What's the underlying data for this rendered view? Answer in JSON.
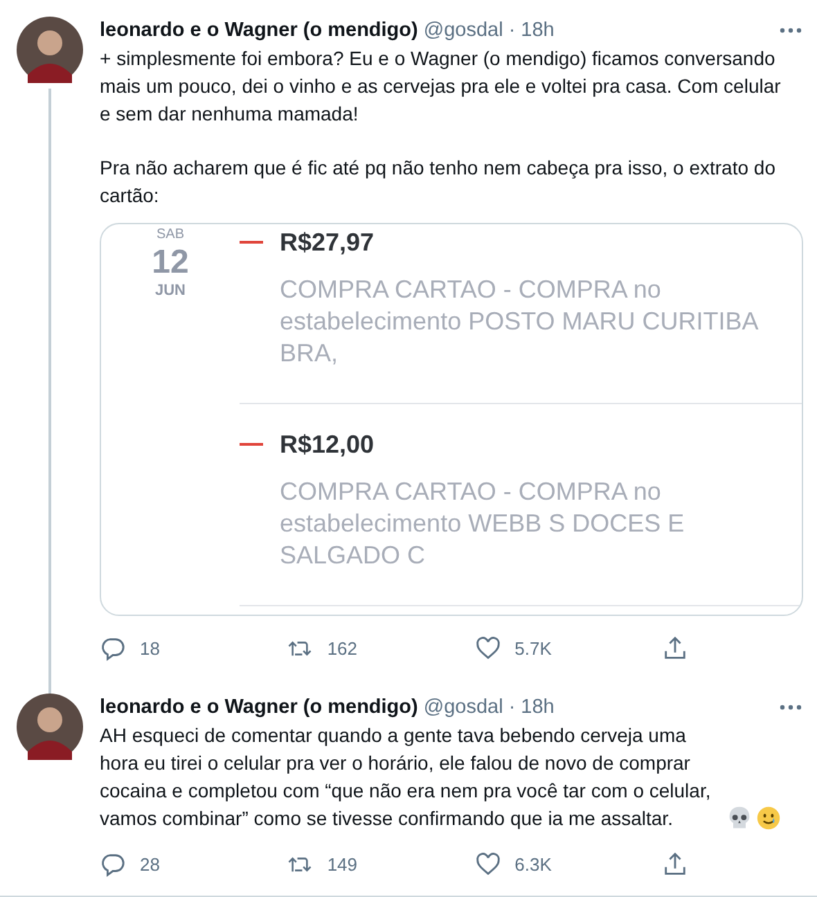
{
  "tweets": [
    {
      "author": "leonardo e o Wagner (o mendigo)",
      "handle": "@gosdal",
      "separator": "·",
      "time": "18h",
      "paragraphs": [
        "+ simplesmente foi embora? Eu e o Wagner (o mendigo) ficamos conversando mais um pouco, dei o vinho e as cervejas pra ele e voltei pra casa. Com celular e sem dar nenhuma mamada!",
        "Pra não acharem que é fic até pq não tenho nem cabeça pra isso, o extrato do cartão:"
      ],
      "attachment": {
        "weekday": "SAB",
        "day": "12",
        "month": "JUN",
        "entries": [
          {
            "amount": "R$27,97",
            "description": "COMPRA CARTAO - COMPRA no estabelecimento POSTO MARU CURITIBA BRA,"
          },
          {
            "amount": "R$12,00",
            "description": "COMPRA CARTAO - COMPRA no estabelecimento WEBB S DOCES E SALGADO C"
          }
        ]
      },
      "replies": "18",
      "retweets": "162",
      "likes": "5.7K"
    },
    {
      "author": "leonardo e o Wagner (o mendigo)",
      "handle": "@gosdal",
      "separator": "·",
      "time": "18h",
      "paragraphs": [
        "AH esqueci de comentar quando a gente tava bebendo cerveja uma hora eu tirei o celular pra ver o horário, ele falou de novo de comprar cocaina e completou com “que não era nem pra você tar com o celular, vamos combinar” como se tivesse confirmando que ia me assaltar."
      ],
      "emoji": [
        {
          "kind": "skull"
        },
        {
          "kind": "smile-tear"
        }
      ],
      "replies": "28",
      "retweets": "149",
      "likes": "6.3K"
    }
  ]
}
